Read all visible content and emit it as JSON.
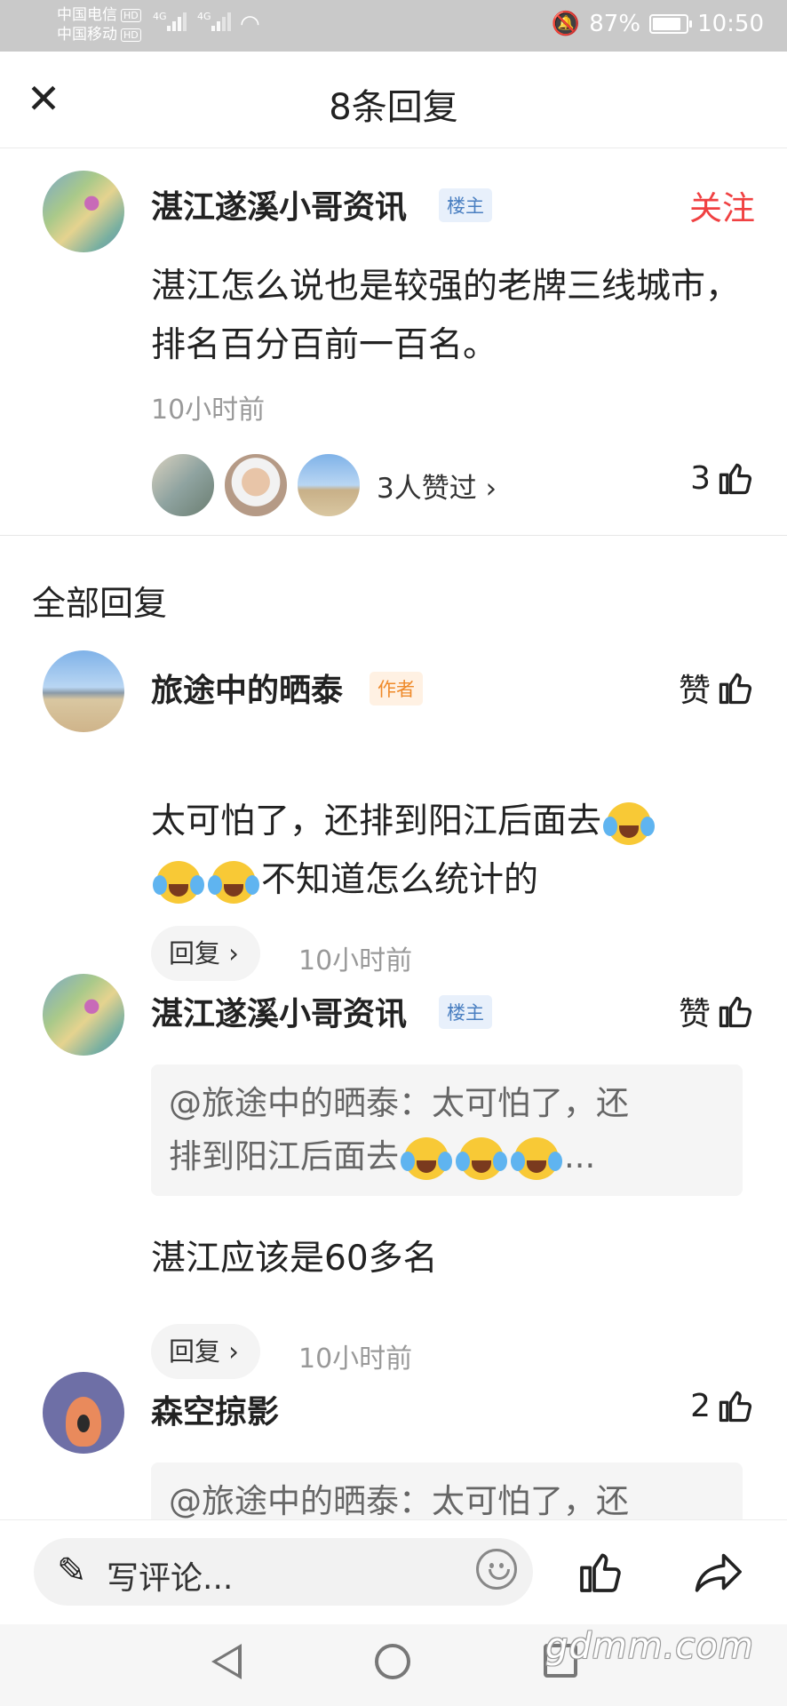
{
  "status_bar": {
    "carrier1": "中国电信",
    "carrier2": "中国移动",
    "hd": "HD",
    "net1": "4G",
    "net2": "4G",
    "battery_percent": "87%",
    "battery_level": 0.87,
    "time": "10:50"
  },
  "header": {
    "title": "8条回复"
  },
  "main_comment": {
    "username": "湛江遂溪小哥资讯",
    "badge": "楼主",
    "follow_label": "关注",
    "text": "湛江怎么说也是较强的老牌三线城市，排名百分百前一百名。",
    "time": "10小时前",
    "likers_text": "3人赞过 ›",
    "like_count": "3"
  },
  "section_title": "全部回复",
  "replies": [
    {
      "username": "旅途中的晒泰",
      "badge": "作者",
      "like_label": "赞",
      "text_a": "太可怕了，还排到阳江后面去",
      "text_b": "不知道怎么统计的",
      "reply_label": "回复 ›",
      "time": "10小时前"
    },
    {
      "username": "湛江遂溪小哥资讯",
      "badge": "楼主",
      "like_label": "赞",
      "quote_a": "@旅途中的晒泰：太可怕了，还",
      "quote_b": "排到阳江后面去",
      "quote_ellipsis": "...",
      "text": "湛江应该是60多名",
      "reply_label": "回复 ›",
      "time": "10小时前"
    },
    {
      "username": "森空掠影",
      "like_count": "2",
      "quote_a": "@旅途中的晒泰：太可怕了，还"
    }
  ],
  "bottom_bar": {
    "comment_placeholder": "写评论..."
  },
  "watermark": "gdmm.com",
  "icons": {
    "close": "close-icon",
    "like": "thumbs-up-icon",
    "share": "share-icon",
    "pen": "pen-icon",
    "emoji": "emoji-icon",
    "crying": "crying-laughing-emoji"
  },
  "colors": {
    "follow": "#f04142",
    "badge_lz": "#4a7fc1",
    "badge_author": "#ef8a2a"
  }
}
